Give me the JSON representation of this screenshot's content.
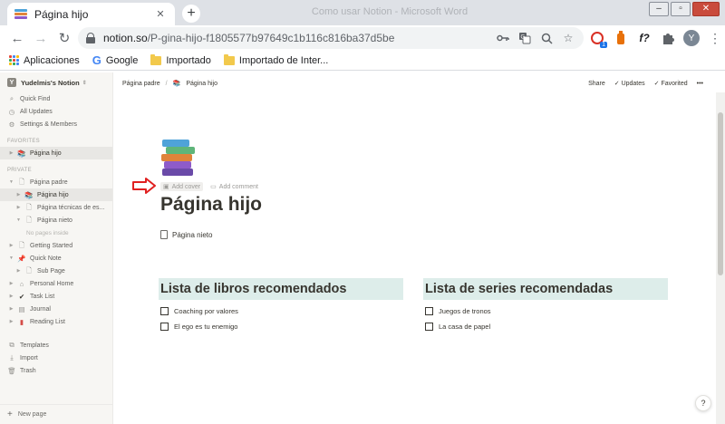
{
  "browser": {
    "tab_title": "Página hijo",
    "tab_close": "✕",
    "new_tab": "+",
    "window_title": "Como usar Notion - Microsoft Word",
    "url_domain": "notion.so",
    "url_path": "/P-gina-hijo-f1805577b97649c1b116c816ba37d5be",
    "profile_initial": "Y",
    "ext_badge": "1",
    "ext_font_label": "f?"
  },
  "bookmarks": [
    {
      "label": "Aplicaciones",
      "icon": "apps-icon"
    },
    {
      "label": "Google",
      "icon": "google-icon"
    },
    {
      "label": "Importado",
      "icon": "folder-icon"
    },
    {
      "label": "Importado de Inter...",
      "icon": "folder-icon"
    }
  ],
  "sidebar": {
    "workspace": "Yudelmis's Notion",
    "workspace_initial": "Y",
    "top_items": [
      {
        "label": "Quick Find",
        "icon": "search-icon"
      },
      {
        "label": "All Updates",
        "icon": "clock-icon"
      },
      {
        "label": "Settings & Members",
        "icon": "gear-icon"
      }
    ],
    "favorites_label": "FAVORITES",
    "favorites": [
      {
        "label": "Página hijo",
        "icon": "books-icon"
      }
    ],
    "private_label": "PRIVATE",
    "private": [
      {
        "label": "Página padre"
      },
      {
        "label": "Página hijo"
      },
      {
        "label": "Página técnicas de es..."
      },
      {
        "label": "Página nieto"
      },
      {
        "label": "No pages inside"
      },
      {
        "label": "Getting Started"
      },
      {
        "label": "Quick Note"
      },
      {
        "label": "Sub Page"
      },
      {
        "label": "Personal Home"
      },
      {
        "label": "Task List"
      },
      {
        "label": "Journal"
      },
      {
        "label": "Reading List"
      }
    ],
    "bottom_items": [
      {
        "label": "Templates",
        "icon": "templates-icon"
      },
      {
        "label": "Import",
        "icon": "import-icon"
      },
      {
        "label": "Trash",
        "icon": "trash-icon"
      }
    ],
    "new_page": "New page"
  },
  "topbar": {
    "breadcrumb_parent": "Página padre",
    "breadcrumb_sep": "/",
    "breadcrumb_current": "Página hijo",
    "share": "Share",
    "updates": "Updates",
    "favorited": "Favorited",
    "more": "•••"
  },
  "page": {
    "add_cover": "Add cover",
    "add_comment": "Add comment",
    "title": "Página hijo",
    "subpage": "Página nieto",
    "columns": [
      {
        "heading": "Lista de libros recomendados",
        "items": [
          "Coaching por valores",
          "El ego es tu enemigo"
        ]
      },
      {
        "heading": "Lista de series recomendadas",
        "items": [
          "Juegos de tronos",
          "La casa de papel"
        ]
      }
    ],
    "help": "?"
  },
  "colors": {
    "heading_highlight": "#ddedea",
    "arrow_red": "#e02020",
    "sidebar_bg": "#f7f6f3"
  }
}
